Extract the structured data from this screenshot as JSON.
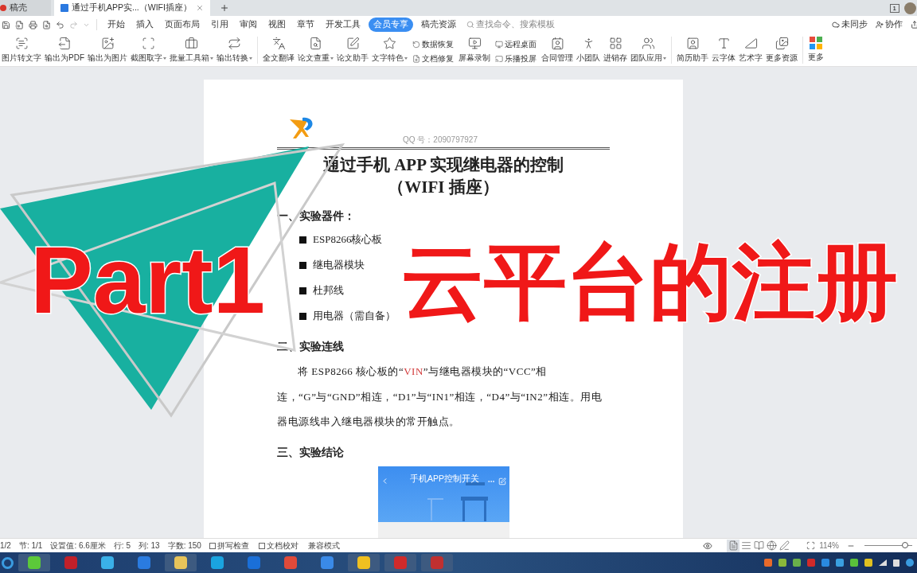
{
  "tabs": [
    {
      "label": "稿壳",
      "selected": false
    },
    {
      "label": "通过手机APP实...（WIFI插座）",
      "selected": true
    }
  ],
  "window_badge": "1",
  "menu": [
    {
      "label": "开始",
      "selected": false
    },
    {
      "label": "插入",
      "selected": false
    },
    {
      "label": "页面布局",
      "selected": false
    },
    {
      "label": "引用",
      "selected": false
    },
    {
      "label": "审阅",
      "selected": false
    },
    {
      "label": "视图",
      "selected": false
    },
    {
      "label": "章节",
      "selected": false
    },
    {
      "label": "开发工具",
      "selected": false
    },
    {
      "label": "会员专享",
      "selected": true
    },
    {
      "label": "稿壳资源",
      "selected": false
    }
  ],
  "search": {
    "placeholder": "查找命令、搜索模板"
  },
  "account_actions": [
    "未同步",
    "协作"
  ],
  "ribbon": [
    {
      "kind": "large",
      "label": "图片转文字",
      "dropdown": false
    },
    {
      "kind": "large",
      "label": "输出为PDF",
      "dropdown": false
    },
    {
      "kind": "large",
      "label": "输出为图片",
      "dropdown": false
    },
    {
      "kind": "large",
      "label": "截图取字",
      "dropdown": true
    },
    {
      "kind": "large",
      "label": "批量工具箱",
      "dropdown": true
    },
    {
      "kind": "large",
      "label": "输出转换",
      "dropdown": true
    },
    {
      "kind": "separator"
    },
    {
      "kind": "large",
      "label": "全文翻译",
      "dropdown": false
    },
    {
      "kind": "large",
      "label": "论文查重",
      "dropdown": true
    },
    {
      "kind": "large",
      "label": "论文助手",
      "dropdown": false
    },
    {
      "kind": "large",
      "label": "文字特色",
      "dropdown": true
    },
    {
      "kind": "pair",
      "items": [
        "数据恢复",
        "文档修复"
      ]
    },
    {
      "kind": "large",
      "label": "屏幕录制",
      "dropdown": false
    },
    {
      "kind": "pair",
      "items": [
        "远程桌面",
        "乐播投屏"
      ]
    },
    {
      "kind": "large",
      "label": "合同管理",
      "dropdown": false
    },
    {
      "kind": "large",
      "label": "小团队",
      "dropdown": false
    },
    {
      "kind": "large",
      "label": "进销存",
      "dropdown": false
    },
    {
      "kind": "large",
      "label": "团队应用",
      "dropdown": true
    },
    {
      "kind": "separator"
    },
    {
      "kind": "large",
      "label": "简历助手",
      "dropdown": false
    },
    {
      "kind": "large",
      "label": "云字体",
      "dropdown": false
    },
    {
      "kind": "large",
      "label": "艺术字",
      "dropdown": false
    },
    {
      "kind": "large",
      "label": "更多资源",
      "dropdown": false
    },
    {
      "kind": "separator"
    },
    {
      "kind": "large",
      "label": "更多",
      "dropdown": false
    }
  ],
  "document": {
    "header": "QQ 号：2090797927",
    "title": [
      "通过手机 APP 实现继电器的控制",
      "（WIFI 插座）"
    ],
    "sections": [
      {
        "heading": "一、实验器件：",
        "bullets": [
          "ESP8266核心板",
          "继电器模块",
          "杜邦线",
          "用电器（需自备）"
        ]
      },
      {
        "heading": "二、实验连线",
        "paragraph": [
          {
            "text": "将 ESP8266 核心板的“",
            "highlight": false
          },
          {
            "text": "VIN",
            "highlight": true
          },
          {
            "text": "”与继电器模块的“VCC”相连，“G”与“GND”相连，“D1”与“IN1”相连，“D4”与“IN2”相连。用电器电源线串入继电器模块的常开触点。",
            "highlight": false
          }
        ]
      },
      {
        "heading": "三、实验结论",
        "screenshot_title": "手机APP控制开关"
      }
    ]
  },
  "overlay_title": [
    "Part1",
    "云平台的注册"
  ],
  "status_bar": [
    "1/2",
    "节: 1/1",
    "设置值: 6.6厘米",
    "行: 5",
    "列: 13",
    "字数: 150"
  ],
  "status_toggles": [
    "拼写检查",
    "文档校对"
  ],
  "status_mode": "兼容模式",
  "views": [
    {
      "kind": "page",
      "selected": true
    },
    {
      "kind": "outline",
      "selected": false
    },
    {
      "kind": "read",
      "selected": false
    },
    {
      "kind": "web",
      "selected": false
    },
    {
      "kind": "pen",
      "selected": false
    }
  ],
  "zoom": {
    "value": "114%",
    "level": 0.85
  }
}
